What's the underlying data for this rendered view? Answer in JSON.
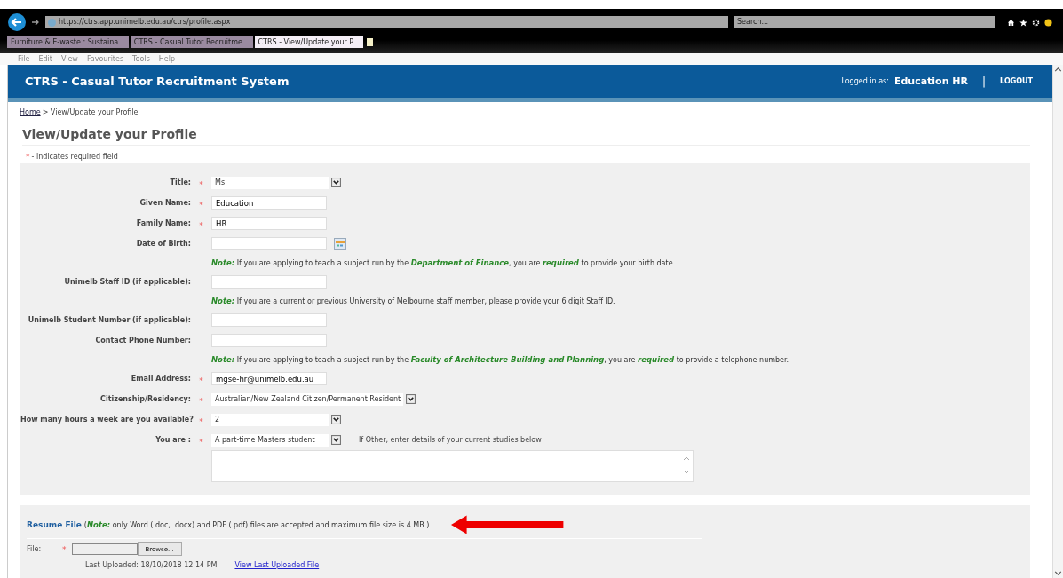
{
  "browser": {
    "url": "https://ctrs.app.unimelb.edu.au/ctrs/profile.aspx",
    "search_placeholder": "Search...",
    "tabs": [
      {
        "label": "Furniture & E-waste : Sustaina...",
        "selected": false
      },
      {
        "label": "CTRS - Casual Tutor Recruitme...",
        "selected": false
      },
      {
        "label": "CTRS - View/Update your P...",
        "selected": true
      }
    ],
    "menu": [
      "File",
      "Edit",
      "View",
      "Favourites",
      "Tools",
      "Help"
    ]
  },
  "header": {
    "title": "CTRS - Casual Tutor Recruitment System",
    "logged_in_label": "Logged in as:",
    "user": "Education HR",
    "separator": "|",
    "logout": "LOGOUT"
  },
  "breadcrumb": {
    "home": "Home",
    "current": "> View/Update your Profile"
  },
  "page_title": "View/Update your Profile",
  "required_legend": {
    "star": "*",
    "text": "- indicates required field"
  },
  "form_rows": [
    {
      "kind": "select",
      "label": "Title:",
      "required": true,
      "value": "Ms"
    },
    {
      "kind": "text",
      "label": "Given Name:",
      "required": true,
      "value": "Education"
    },
    {
      "kind": "text",
      "label": "Family Name:",
      "required": true,
      "value": "HR"
    },
    {
      "kind": "date",
      "label": "Date of Birth:",
      "required": false,
      "value": ""
    },
    {
      "kind": "note",
      "text": "**Note:** If you are applying to teach a subject run by the **Department of Finance**, you are **required** to provide your birth date."
    },
    {
      "kind": "text",
      "label": "Unimelb Staff ID (if applicable):",
      "required": false,
      "value": ""
    },
    {
      "kind": "note",
      "text": "**Note:** If you are a current or previous University of Melbourne staff member, please provide your 6 digit Staff ID."
    },
    {
      "kind": "text",
      "label": "Unimelb Student Number (if applicable):",
      "required": false,
      "value": ""
    },
    {
      "kind": "text",
      "label": "Contact Phone Number:",
      "required": false,
      "value": ""
    },
    {
      "kind": "note",
      "text": "**Note:** If you are applying to teach a subject run by the **Faculty of Architecture Building and Planning**, you are **required** to provide a telephone number."
    },
    {
      "kind": "text",
      "label": "Email Address:",
      "required": true,
      "value": "mgse-hr@unimelb.edu.au"
    },
    {
      "kind": "select",
      "label": "Citizenship/Residency:",
      "required": true,
      "value": "Australian/New Zealand Citizen/Permanent Resident"
    },
    {
      "kind": "select",
      "label": "How many hours a week are you available?",
      "required": true,
      "value": "2"
    },
    {
      "kind": "select",
      "label": "You are :",
      "required": true,
      "value": "A part-time Masters student",
      "hint": "If Other, enter details of your current studies below"
    },
    {
      "kind": "textarea",
      "value": ""
    }
  ],
  "resume": {
    "title": "Resume File",
    "note": "(**Note:** only Word (.doc, .docx) and PDF (.pdf) files are accepted and maximum file size is 4 MB.)",
    "file_label": "File:",
    "required": true,
    "browse": "Browse...",
    "last_uploaded": "Last Uploaded: 18/10/2018 12:14 PM",
    "view_link": "View Last Uploaded File"
  }
}
